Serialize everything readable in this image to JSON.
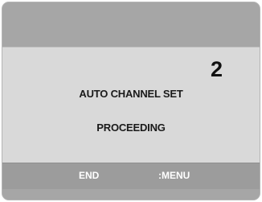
{
  "osd": {
    "channel_number": "2",
    "title": "AUTO CHANNEL SET",
    "status": "PROCEEDING"
  },
  "footer": {
    "end_label": "END",
    "menu_label": ":MENU"
  },
  "colors": {
    "frame": "#a6a6a6",
    "panel": "#d9d9d9",
    "text": "#1a1a1a",
    "footer_text": "#ffffff"
  }
}
